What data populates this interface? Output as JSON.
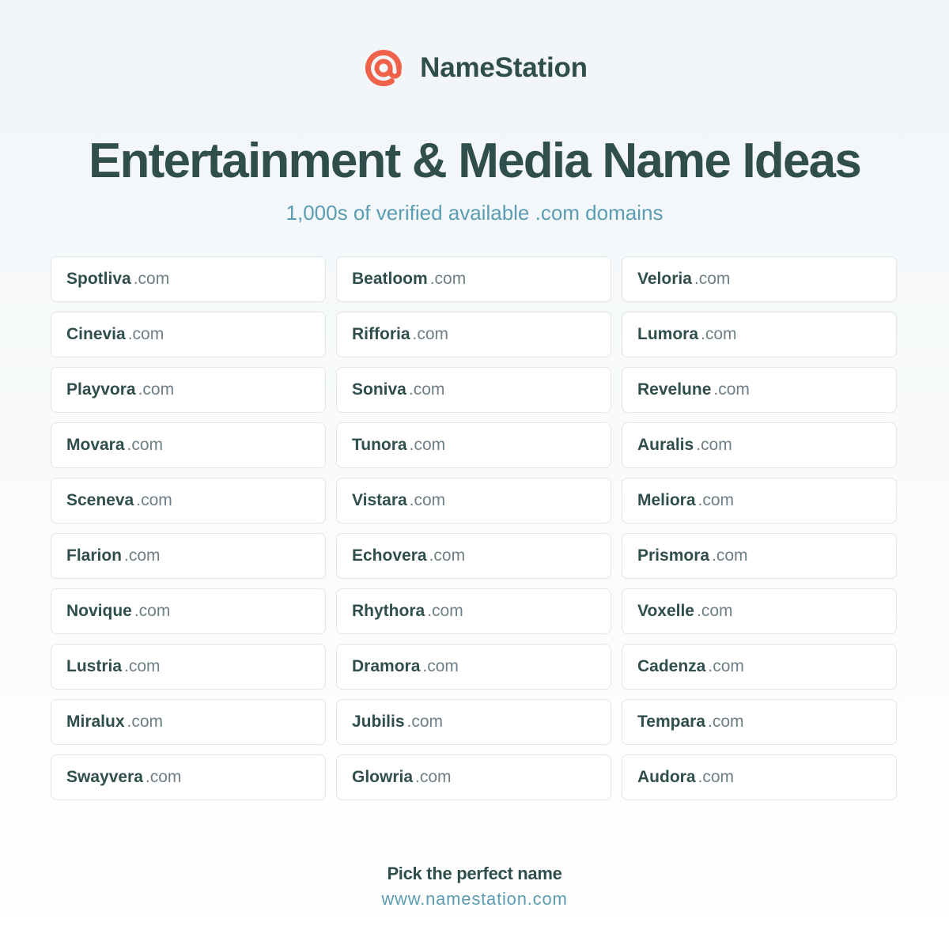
{
  "brand": {
    "name": "NameStation",
    "logo_icon": "target-at-icon",
    "logo_color": "#f0614a"
  },
  "headline": "Entertainment & Media Name Ideas",
  "subheadline": "1,000s of verified available .com domains",
  "domains": [
    {
      "name": "Spotliva",
      "tld": ".com"
    },
    {
      "name": "Beatloom",
      "tld": ".com"
    },
    {
      "name": "Veloria",
      "tld": ".com"
    },
    {
      "name": "Cinevia",
      "tld": ".com"
    },
    {
      "name": "Rifforia",
      "tld": ".com"
    },
    {
      "name": "Lumora",
      "tld": ".com"
    },
    {
      "name": "Playvora",
      "tld": ".com"
    },
    {
      "name": "Soniva",
      "tld": ".com"
    },
    {
      "name": "Revelune",
      "tld": ".com"
    },
    {
      "name": "Movara",
      "tld": ".com"
    },
    {
      "name": "Tunora",
      "tld": ".com"
    },
    {
      "name": "Auralis",
      "tld": ".com"
    },
    {
      "name": "Sceneva",
      "tld": ".com"
    },
    {
      "name": "Vistara",
      "tld": ".com"
    },
    {
      "name": "Meliora",
      "tld": ".com"
    },
    {
      "name": "Flarion",
      "tld": ".com"
    },
    {
      "name": "Echovera",
      "tld": ".com"
    },
    {
      "name": "Prismora",
      "tld": ".com"
    },
    {
      "name": "Novique",
      "tld": ".com"
    },
    {
      "name": "Rhythora",
      "tld": ".com"
    },
    {
      "name": "Voxelle",
      "tld": ".com"
    },
    {
      "name": "Lustria",
      "tld": ".com"
    },
    {
      "name": "Dramora",
      "tld": ".com"
    },
    {
      "name": "Cadenza",
      "tld": ".com"
    },
    {
      "name": "Miralux",
      "tld": ".com"
    },
    {
      "name": "Jubilis",
      "tld": ".com"
    },
    {
      "name": "Tempara",
      "tld": ".com"
    },
    {
      "name": "Swayvera",
      "tld": ".com"
    },
    {
      "name": "Glowria",
      "tld": ".com"
    },
    {
      "name": "Audora",
      "tld": ".com"
    }
  ],
  "footer": {
    "tagline": "Pick the perfect name",
    "url": "www.namestation.com"
  }
}
